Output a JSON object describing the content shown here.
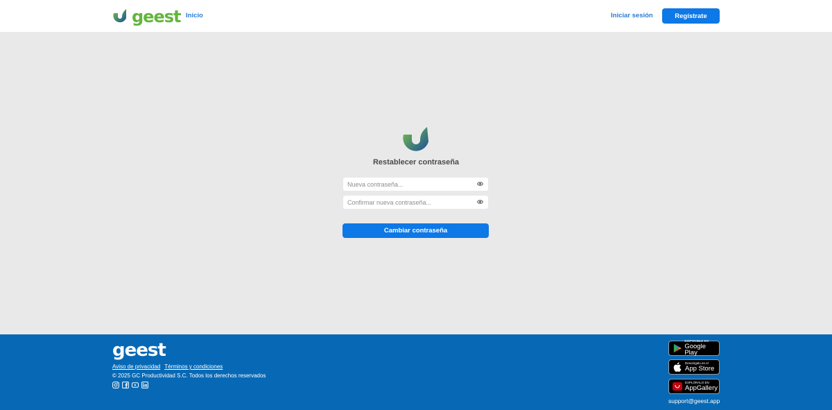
{
  "header": {
    "logo_text": "geest",
    "home_link": "Inicio",
    "login_link": "Iniciar sesión",
    "register_button": "Regístrate"
  },
  "form": {
    "title": "Restablecer contraseña",
    "new_password_placeholder": "Nueva contraseña...",
    "confirm_password_placeholder": "Confirmar nueva contraseña...",
    "submit_button": "Cambiar contraseña"
  },
  "footer": {
    "logo_text": "geest",
    "privacy_link": "Aviso de privacidad",
    "terms_link": "Términos y condiciones",
    "copyright": "© 2025 GC Productividad S.C. Todos los derechos reservados",
    "social_icons": [
      "instagram-icon",
      "facebook-icon",
      "youtube-icon",
      "linkedin-icon"
    ],
    "badges": [
      {
        "small": "DISPONIBLE EN",
        "big": "Google Play",
        "icon": "google-play-icon"
      },
      {
        "small": "Descárgalo en el",
        "big": "App Store",
        "icon": "apple-icon"
      },
      {
        "small": "EXPLÓRALO EN",
        "big": "AppGallery",
        "icon": "huawei-icon"
      }
    ],
    "support_email": "support@geest.app"
  },
  "colors": {
    "primary": "#0d78e6",
    "footer_bg": "#0769b5",
    "page_bg": "#e9e9e9",
    "logo_green": "#63b53d",
    "logo_blue": "#1a4f9c"
  }
}
